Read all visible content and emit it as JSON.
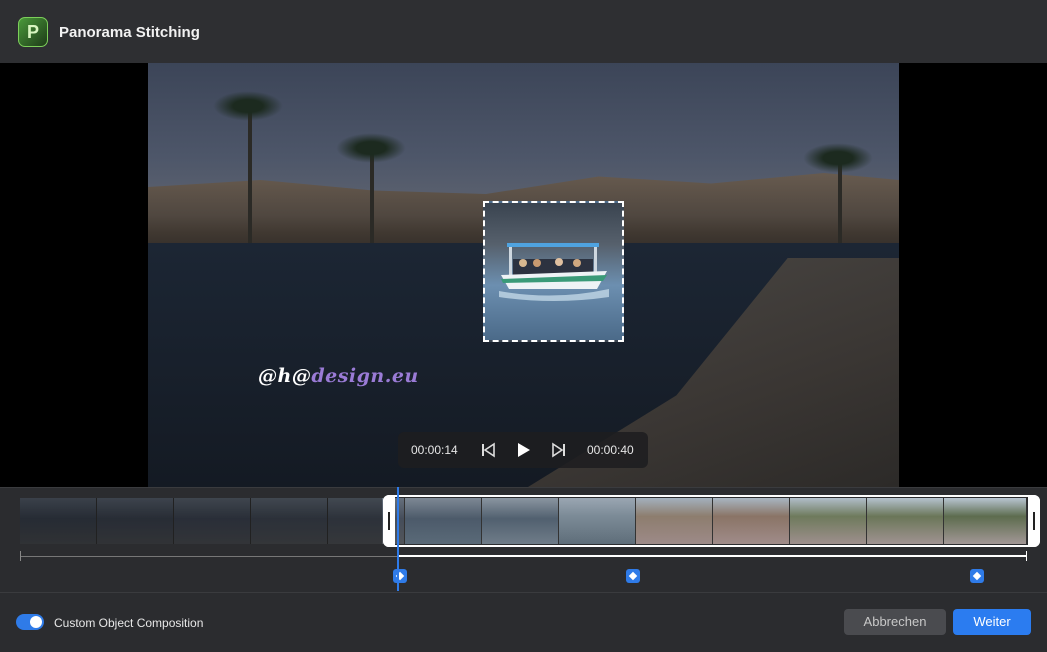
{
  "app": {
    "logo_letter": "P",
    "title": "Panorama Stitching"
  },
  "viewer": {
    "watermark_prefix": "@h@",
    "watermark_suffix": "design.eu",
    "player": {
      "current_time": "00:00:14",
      "total_time": "00:00:40"
    }
  },
  "timeline": {
    "frame_count": 13,
    "keyframes": 3
  },
  "footer": {
    "toggle_label": "Custom Object Composition",
    "toggle_on": true,
    "cancel_label": "Abbrechen",
    "next_label": "Weiter"
  },
  "colors": {
    "accent": "#2b7cf0",
    "background": "#2b2c2f"
  }
}
